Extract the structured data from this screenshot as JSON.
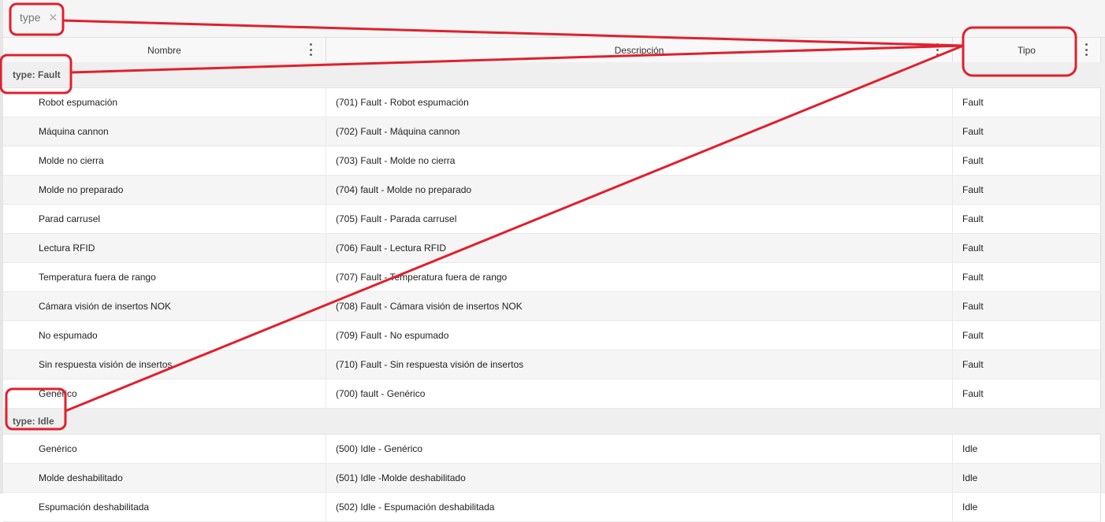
{
  "group_panel": {
    "chip_label": "type",
    "chip_remove": "✕"
  },
  "columns": [
    {
      "label": "Nombre"
    },
    {
      "label": "Descripción"
    },
    {
      "label": "Tipo"
    }
  ],
  "groups": [
    {
      "label": "type: Fault",
      "rows": [
        {
          "nombre": "Robot espumación",
          "descripcion": "(701) Fault - Robot espumación",
          "tipo": "Fault"
        },
        {
          "nombre": "Máquina cannon",
          "descripcion": "(702) Fault - Máquina cannon",
          "tipo": "Fault"
        },
        {
          "nombre": "Molde no cierra",
          "descripcion": "(703) Fault - Molde no cierra",
          "tipo": "Fault"
        },
        {
          "nombre": "Molde no preparado",
          "descripcion": "(704) fault - Molde no preparado",
          "tipo": "Fault"
        },
        {
          "nombre": "Parad carrusel",
          "descripcion": "(705) Fault - Parada carrusel",
          "tipo": "Fault"
        },
        {
          "nombre": "Lectura RFID",
          "descripcion": "(706) Fault - Lectura RFID",
          "tipo": "Fault"
        },
        {
          "nombre": "Temperatura fuera de rango",
          "descripcion": "(707) Fault - Temperatura fuera de rango",
          "tipo": "Fault"
        },
        {
          "nombre": "Cámara visión de insertos NOK",
          "descripcion": "(708) Fault - Cámara visión de insertos NOK",
          "tipo": "Fault"
        },
        {
          "nombre": "No espumado",
          "descripcion": "(709) Fault - No espumado",
          "tipo": "Fault"
        },
        {
          "nombre": "Sin respuesta visión de insertos",
          "descripcion": "(710) Fault - Sin respuesta visión de insertos",
          "tipo": "Fault"
        },
        {
          "nombre": "Genérico",
          "descripcion": "(700) fault - Genérico",
          "tipo": "Fault"
        }
      ]
    },
    {
      "label": "type: Idle",
      "rows": [
        {
          "nombre": "Genérico",
          "descripcion": "(500) Idle - Genérico",
          "tipo": "Idle"
        },
        {
          "nombre": "Molde deshabilitado",
          "descripcion": "(501) Idle -Molde deshabilitado",
          "tipo": "Idle"
        },
        {
          "nombre": "Espumación deshabilitada",
          "descripcion": "(502) Idle - Espumación deshabilitada",
          "tipo": "Idle"
        }
      ]
    }
  ],
  "annotation_color": "#e0202e"
}
